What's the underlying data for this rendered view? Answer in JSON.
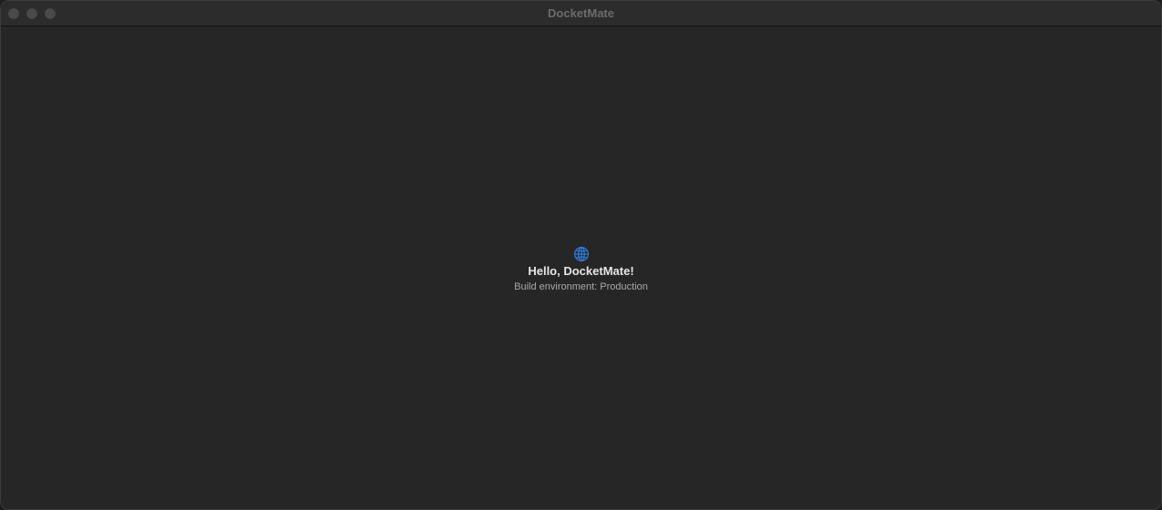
{
  "window": {
    "title": "DocketMate"
  },
  "titlebar": {
    "buttons": [
      {
        "name": "close",
        "color": "#4a4a4a"
      },
      {
        "name": "minimize",
        "color": "#4a4a4a"
      },
      {
        "name": "zoom",
        "color": "#4a4a4a"
      }
    ]
  },
  "main": {
    "icon": "globe-icon",
    "icon_color": "#2f7fe0",
    "greeting": "Hello, DocketMate!",
    "environment_text": "Build environment: Production"
  },
  "colors": {
    "background": "#262626",
    "titlebar": "#2c2c2c",
    "primary_text": "#e6e6e6",
    "secondary_text": "#a8a8a8"
  }
}
